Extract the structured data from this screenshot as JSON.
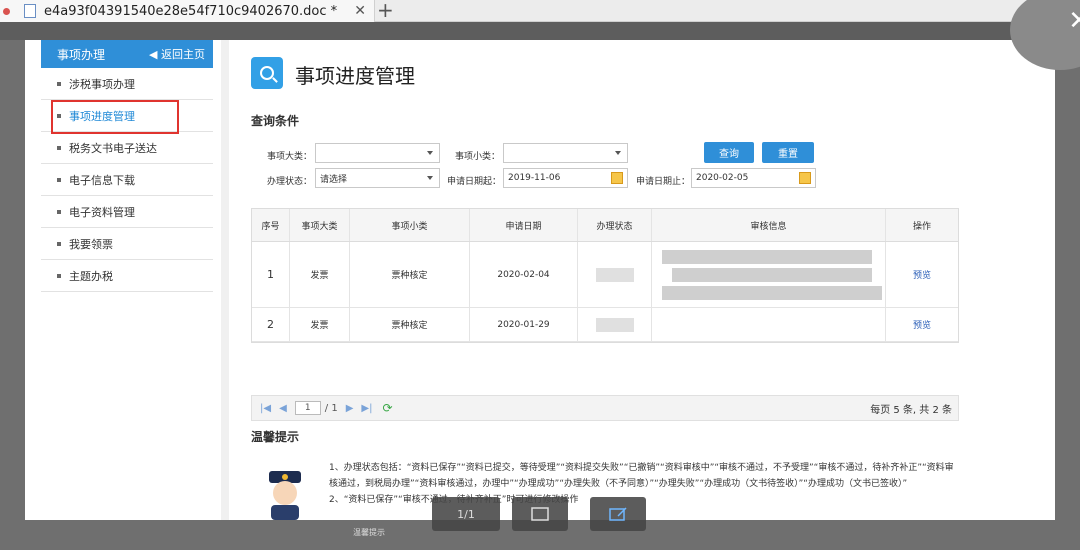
{
  "tab": {
    "title": "e4a93f04391540e28e54f710c9402670.doc *"
  },
  "sidebar": {
    "header": "事项办理",
    "back_label": "◀ 返回主页",
    "items": [
      {
        "label": "涉税事项办理"
      },
      {
        "label": "事项进度管理"
      },
      {
        "label": "税务文书电子送达"
      },
      {
        "label": "电子信息下载"
      },
      {
        "label": "电子资料管理"
      },
      {
        "label": "我要领票"
      },
      {
        "label": "主题办税"
      }
    ]
  },
  "page": {
    "title": "事项进度管理"
  },
  "query": {
    "section_title": "查询条件",
    "category_label": "事项大类：",
    "subcategory_label": "事项小类：",
    "status_label": "办理状态：",
    "status_value": "请选择",
    "start_label": "申请日期起：",
    "start_value": "2019-11-06",
    "end_label": "申请日期止：",
    "end_value": "2020-02-05",
    "search_btn": "查询",
    "reset_btn": "重置"
  },
  "table": {
    "headers": [
      "序号",
      "事项大类",
      "事项小类",
      "申请日期",
      "办理状态",
      "审核信息",
      "操作"
    ],
    "rows": [
      {
        "no": "1",
        "category": "发票",
        "subcategory": "票种核定",
        "date": "2020-02-04",
        "action": "预览"
      },
      {
        "no": "2",
        "category": "发票",
        "subcategory": "票种核定",
        "date": "2020-01-29",
        "action": "预览"
      }
    ]
  },
  "pager": {
    "page_value": "1",
    "total_pages": "/ 1",
    "summary": "每页 5 条, 共 2 条"
  },
  "tips": {
    "title": "温馨提示",
    "line1": "1、办理状态包括：“资料已保存”“资料已提交，等待受理”“资料提交失败”“已撤销”“资料审核中”“审核不通过，不予受理”“审核不通过，待补齐补正”“资料审核通过，到税局办理”“资料审核通过，办理中”“办理成功”“办理失败（不予同意）”“办理失败”“办理成功（文书待签收）”“办理成功（文书已签收）”",
    "line2": "2、“资料已保存”“审核不通过，待补齐补正”时可进行修改操作"
  },
  "viewer": {
    "page_counter": "1/1",
    "note": "温馨提示"
  },
  "colors": {
    "accent": "#2f8fd8",
    "highlight": "#e0342f",
    "link": "#2b5fb8"
  }
}
